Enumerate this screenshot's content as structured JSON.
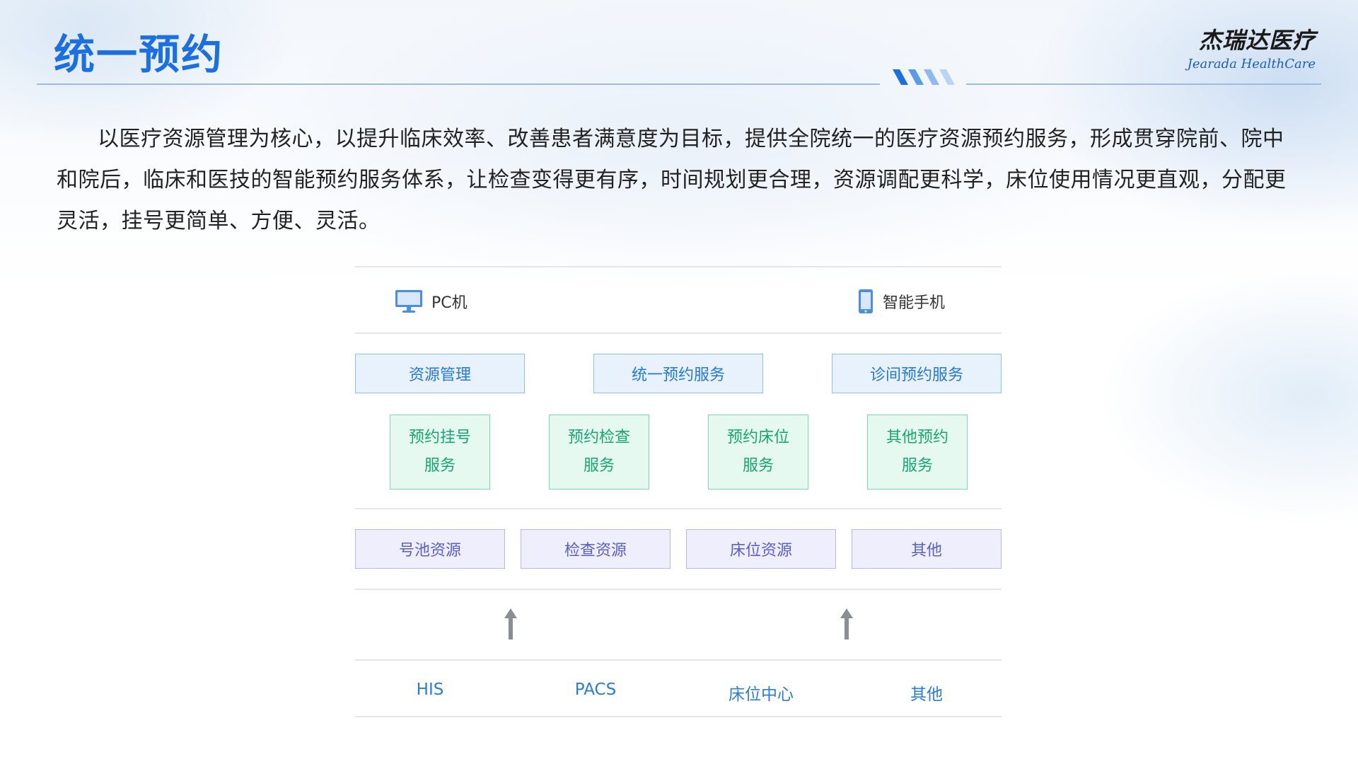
{
  "header": {
    "title": "统一预约",
    "logo_cn": "杰瑞达医疗",
    "logo_en": "Jearada HealthCare",
    "accent_color": "#1b6fe0"
  },
  "intro": {
    "text": "以医疗资源管理为核心，以提升临床效率、改善患者满意度为目标，提供全院统一的医疗资源预约服务，形成贯穿院前、院中和院后，临床和医技的智能预约服务体系，让检查变得更有序，时间规划更合理，资源调配更科学，床位使用情况更直观，分配更灵活，挂号更简单、方便、灵活。"
  },
  "diagram": {
    "devices": [
      {
        "label": "PC机",
        "icon": "monitor-icon"
      },
      {
        "label": "智能手机",
        "icon": "smartphone-icon"
      }
    ],
    "services": [
      "资源管理",
      "统一预约服务",
      "诊间预约服务"
    ],
    "sub_services": [
      "预约挂号服务",
      "预约检查服务",
      "预约床位服务",
      "其他预约服务"
    ],
    "resources": [
      "号池资源",
      "检查资源",
      "床位资源",
      "其他"
    ],
    "arrows": [
      "arrow-up-icon",
      "arrow-up-icon"
    ],
    "sources": [
      "HIS",
      "PACS",
      "床位中心",
      "其他"
    ],
    "colors": {
      "service_bg": "#e8f2fd",
      "service_text": "#2578d6",
      "sub_bg": "#e6f9f1",
      "sub_text": "#16a673",
      "resource_bg": "#eeeefc",
      "resource_text": "#5b60c8",
      "source_text": "#2a7ed6"
    }
  }
}
